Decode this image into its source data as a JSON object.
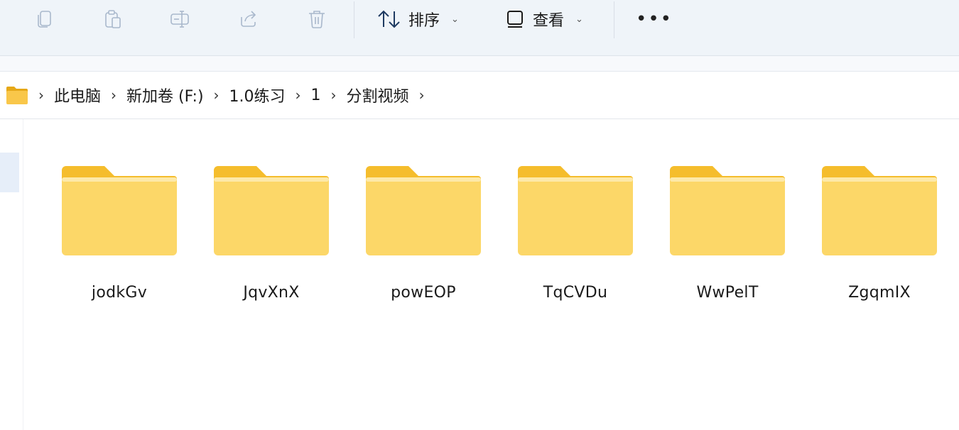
{
  "toolbar": {
    "icons": [
      "copy-icon",
      "paste-icon",
      "rename-icon",
      "share-icon",
      "delete-icon"
    ],
    "sort_label": "排序",
    "view_label": "查看",
    "more_label": "•••"
  },
  "breadcrumb": [
    "此电脑",
    "新加卷 (F:)",
    "1.0练习",
    "1",
    "分割视频"
  ],
  "breadcrumb_sep": "›",
  "folders": [
    "jodkGv",
    "JqvXnX",
    "powEOP",
    "TqCVDu",
    "WwPelT",
    "ZgqmIX"
  ],
  "colors": {
    "folder_back": "#f5bd2c",
    "folder_front": "#fcd768",
    "toolbar_bg": "#eff4f9"
  }
}
